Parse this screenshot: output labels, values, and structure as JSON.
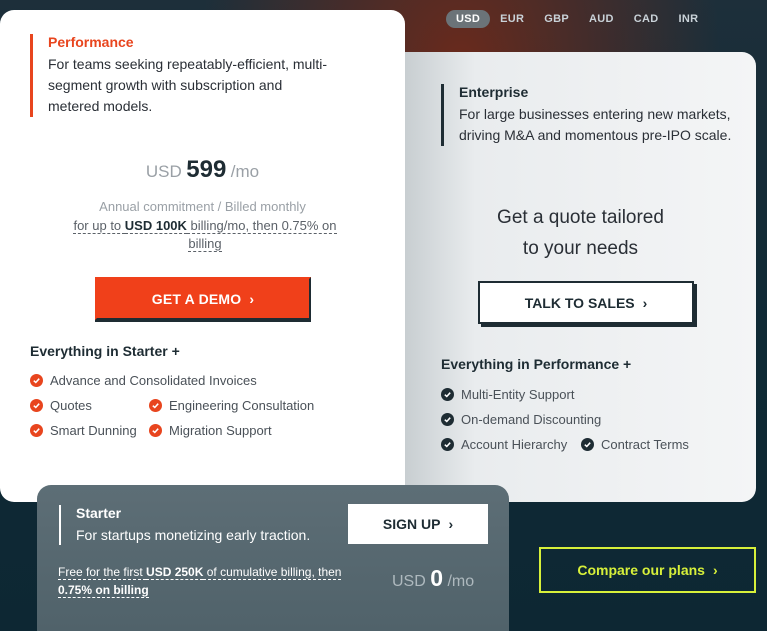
{
  "currencies": [
    "USD",
    "EUR",
    "GBP",
    "AUD",
    "CAD",
    "INR"
  ],
  "selected_currency": "USD",
  "performance": {
    "title": "Performance",
    "description": "For teams seeking repeatably-efficient, multi-segment growth with subscription and metered models.",
    "price_currency": "USD",
    "price_amount": "599",
    "price_period": "/mo",
    "commitment": "Annual commitment / Billed monthly",
    "billing_prefix": "for up to ",
    "billing_bold": "USD 100K",
    "billing_suffix": " billing/mo, then 0.75% on billing",
    "cta": "GET A DEMO",
    "features_title": "Everything in Starter +",
    "features": [
      "Advance and Consolidated Invoices",
      "Quotes",
      "Engineering Consultation",
      "Smart Dunning",
      "Migration Support"
    ]
  },
  "enterprise": {
    "title": "Enterprise",
    "description": "For large businesses entering new markets, driving M&A and momentous pre-IPO scale.",
    "quote_line1": "Get a quote tailored",
    "quote_line2": "to your needs",
    "cta": "TALK TO SALES",
    "features_title": "Everything in Performance +",
    "features": [
      "Multi-Entity Support",
      "On-demand Discounting",
      "Account Hierarchy",
      "Contract Terms"
    ]
  },
  "starter": {
    "title": "Starter",
    "description": "For startups monetizing early traction.",
    "cta": "SIGN UP",
    "free_prefix": "Free for the first ",
    "free_bold": "USD 250K",
    "free_suffix": " of cumulative billing, then",
    "free_line2": "0.75% on billing",
    "price_currency": "USD",
    "price_amount": "0",
    "price_period": "/mo"
  },
  "compare_cta": "Compare our plans",
  "colors": {
    "accent": "#e8451e",
    "dark": "#1e2c33",
    "lime": "#d7f03a"
  }
}
